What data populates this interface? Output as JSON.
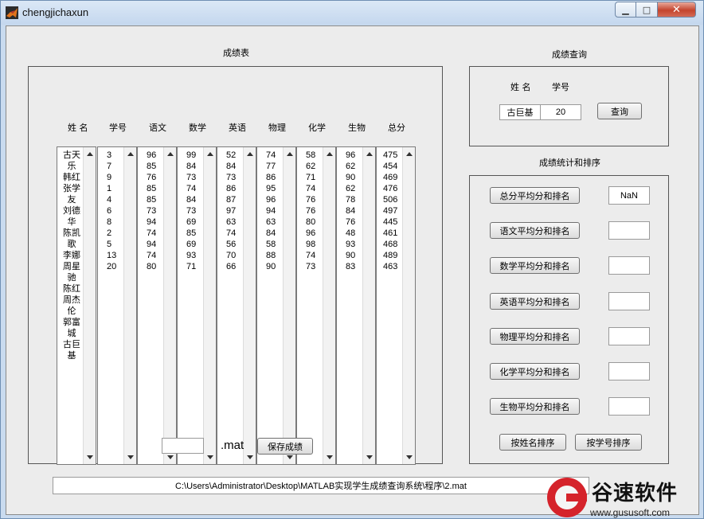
{
  "window": {
    "title": "chengjichaxun",
    "min_glyph": "▁",
    "max_glyph": "□",
    "close_glyph": "✕"
  },
  "score_table": {
    "title": "成绩表",
    "headers": [
      "姓 名",
      "学号",
      "语文",
      "数学",
      "英语",
      "物理",
      "化学",
      "生物",
      "总分"
    ],
    "names_wrapped": [
      "古天",
      "乐",
      "韩红",
      "张学",
      "友",
      "刘德",
      "华",
      "陈凯",
      "歌",
      "李娜",
      "周星",
      "驰",
      "陈红",
      "周杰",
      "伦",
      "郭富",
      "城",
      "古巨",
      "基"
    ],
    "ids": [
      "3",
      "7",
      "9",
      "1",
      "4",
      "6",
      "8",
      "2",
      "5",
      "13",
      "20"
    ],
    "chinese": [
      "96",
      "85",
      "76",
      "85",
      "85",
      "73",
      "94",
      "74",
      "94",
      "74",
      "80"
    ],
    "math": [
      "99",
      "84",
      "73",
      "74",
      "84",
      "73",
      "69",
      "85",
      "69",
      "93",
      "71"
    ],
    "english": [
      "52",
      "84",
      "73",
      "86",
      "87",
      "97",
      "63",
      "74",
      "56",
      "70",
      "66"
    ],
    "physics": [
      "74",
      "77",
      "86",
      "95",
      "96",
      "94",
      "63",
      "84",
      "58",
      "88",
      "90"
    ],
    "chemistry": [
      "58",
      "62",
      "71",
      "74",
      "76",
      "76",
      "80",
      "96",
      "98",
      "74",
      "73"
    ],
    "biology": [
      "96",
      "62",
      "90",
      "62",
      "78",
      "84",
      "76",
      "48",
      "93",
      "90",
      "83"
    ],
    "total": [
      "475",
      "454",
      "469",
      "476",
      "506",
      "497",
      "445",
      "461",
      "468",
      "489",
      "463"
    ],
    "filename_value": "",
    "mat_label": ".mat",
    "save_label": "保存成绩"
  },
  "query": {
    "title": "成绩查询",
    "name_label": "姓 名",
    "id_label": "学号",
    "name_value": "古巨基",
    "id_value": "20",
    "query_button": "查询"
  },
  "stats": {
    "title": "成绩统计和排序",
    "rows": [
      {
        "label": "总分平均分和排名",
        "value": "NaN"
      },
      {
        "label": "语文平均分和排名",
        "value": ""
      },
      {
        "label": "数学平均分和排名",
        "value": ""
      },
      {
        "label": "英语平均分和排名",
        "value": ""
      },
      {
        "label": "物理平均分和排名",
        "value": ""
      },
      {
        "label": "化学平均分和排名",
        "value": ""
      },
      {
        "label": "生物平均分和排名",
        "value": ""
      }
    ],
    "sort_by_name": "按姓名排序",
    "sort_by_id": "按学号排序"
  },
  "path": "C:\\Users\\Administrator\\Desktop\\MATLAB实现学生成绩查询系统\\程序\\2.mat",
  "watermark": {
    "text": "谷速软件",
    "url": "www.gususoft.com"
  },
  "colors": {
    "client_bg": "#ececec",
    "title_bar": "#c4d7ee",
    "close_button": "#c4442d",
    "watermark_red": "#d5232b"
  }
}
